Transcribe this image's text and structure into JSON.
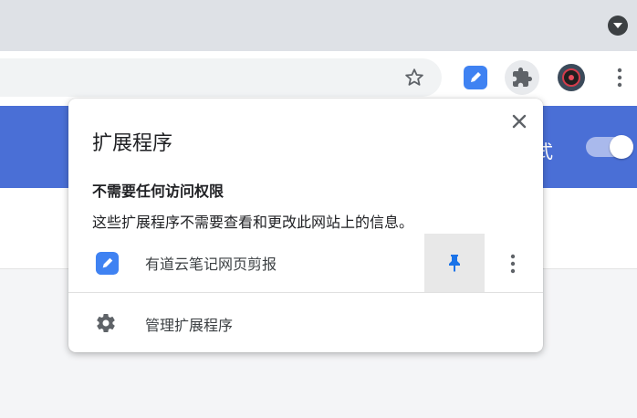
{
  "popup": {
    "title": "扩展程序",
    "section_heading": "不需要任何访问权限",
    "section_desc": "这些扩展程序不需要查看和更改此网站上的信息。",
    "extensions": [
      {
        "name": "有道云笔记网页剪报",
        "icon": "youdao-note-icon",
        "pinned": true
      }
    ],
    "manage_label": "管理扩展程序"
  },
  "page": {
    "banner_text": "式"
  },
  "colors": {
    "tabstrip": "#dee1e6",
    "banner": "#4a6fd6",
    "pin_accent": "#1a73e8",
    "youdao_blue": "#3f82f2"
  }
}
